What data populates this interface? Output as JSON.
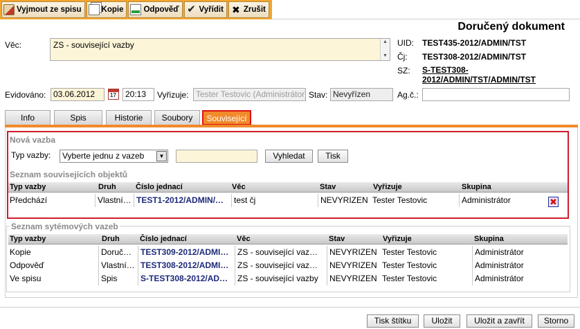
{
  "toolbar": {
    "buttons": [
      {
        "label": "Vyjmout ze spisu",
        "icon": "cut-icon"
      },
      {
        "label": "Kopie",
        "icon": "copy-icon"
      },
      {
        "label": "Odpověď",
        "icon": "reply-icon"
      },
      {
        "label": "Vyřídit",
        "icon": "check-icon"
      },
      {
        "label": "Zrušit",
        "icon": "close-icon"
      }
    ]
  },
  "header": {
    "title": "Doručený dokument"
  },
  "form": {
    "vec_label": "Věc:",
    "vec_value": "ZS - související vazby",
    "uid_label": "UID:",
    "uid_value": "TEST435-2012/ADMIN/TST",
    "cj_label": "Čj:",
    "cj_value": "TEST308-2012/ADMIN/TST",
    "sz_label": "SZ:",
    "sz_value": "S-TEST308-2012/ADMIN/TST/ADMIN/TST",
    "evidovano_label": "Evidováno:",
    "evidovano_date": "03.06.2012",
    "evidovano_time": "20:13",
    "calendar_text": "17",
    "vyrizuje_label": "Vyřizuje:",
    "vyrizuje_value": "Tester Testovic (Administrátor)",
    "stav_label": "Stav:",
    "stav_value": "Nevyřízen",
    "agc_label": "Ag.č.:",
    "agc_value": ""
  },
  "tabs": [
    {
      "label": "Info"
    },
    {
      "label": "Spis"
    },
    {
      "label": "Historie"
    },
    {
      "label": "Soubory"
    },
    {
      "label": "Související",
      "active": true
    }
  ],
  "nova_vazba": {
    "title": "Nová vazba",
    "typ_label": "Typ vazby:",
    "typ_selected": "Vyberte jednu z vazeb",
    "search_value": "",
    "vyhledat_label": "Vyhledat",
    "tisk_label": "Tisk"
  },
  "souvisejici": {
    "title": "Seznam souvisejících objektů",
    "columns": [
      "Typ vazby",
      "Druh",
      "Číslo jednací",
      "Věc",
      "Stav",
      "Vyřizuje",
      "Skupina"
    ],
    "rows": [
      {
        "typ": "Předchází",
        "druh": "Vlastní…",
        "cj": "TEST1-2012/ADMIN/…",
        "vec": "test čj",
        "stav": "NEVYRIZEN",
        "vyrizuje": "Tester Testovic",
        "skupina": "Administrátor"
      }
    ]
  },
  "systemove": {
    "title": "Seznam sytémových vazeb",
    "columns": [
      "Typ vazby",
      "Druh",
      "Číslo jednací",
      "Věc",
      "Stav",
      "Vyřizuje",
      "Skupina"
    ],
    "rows": [
      {
        "typ": "Kopie",
        "druh": "Doruč…",
        "cj": "TEST309-2012/ADMI…",
        "vec": "ZS - související vaz…",
        "stav": "NEVYRIZEN",
        "vyrizuje": "Tester Testovic",
        "skupina": "Administrátor"
      },
      {
        "typ": "Odpověď",
        "druh": "Vlastní…",
        "cj": "TEST308-2012/ADMI…",
        "vec": "ZS - související vaz…",
        "stav": "NEVYRIZEN",
        "vyrizuje": "Tester Testovic",
        "skupina": "Administrátor"
      },
      {
        "typ": "Ve spisu",
        "druh": "Spis",
        "cj": "S-TEST308-2012/AD…",
        "vec": "ZS - související vazby",
        "stav": "NEVYRIZEN",
        "vyrizuje": "Tester Testovic",
        "skupina": "Administrátor"
      }
    ]
  },
  "footer": {
    "buttons": [
      {
        "label": "Tisk štítku"
      },
      {
        "label": "Uložit"
      },
      {
        "label": "Uložit a zavřít"
      },
      {
        "label": "Storno"
      }
    ]
  },
  "colors": {
    "toolbar": "#f3a52d",
    "tab_active": "#f18a2b",
    "highlight": "#d01c2a",
    "input_yellow": "#fdf5d8",
    "link_blue": "#1d2a7a"
  }
}
